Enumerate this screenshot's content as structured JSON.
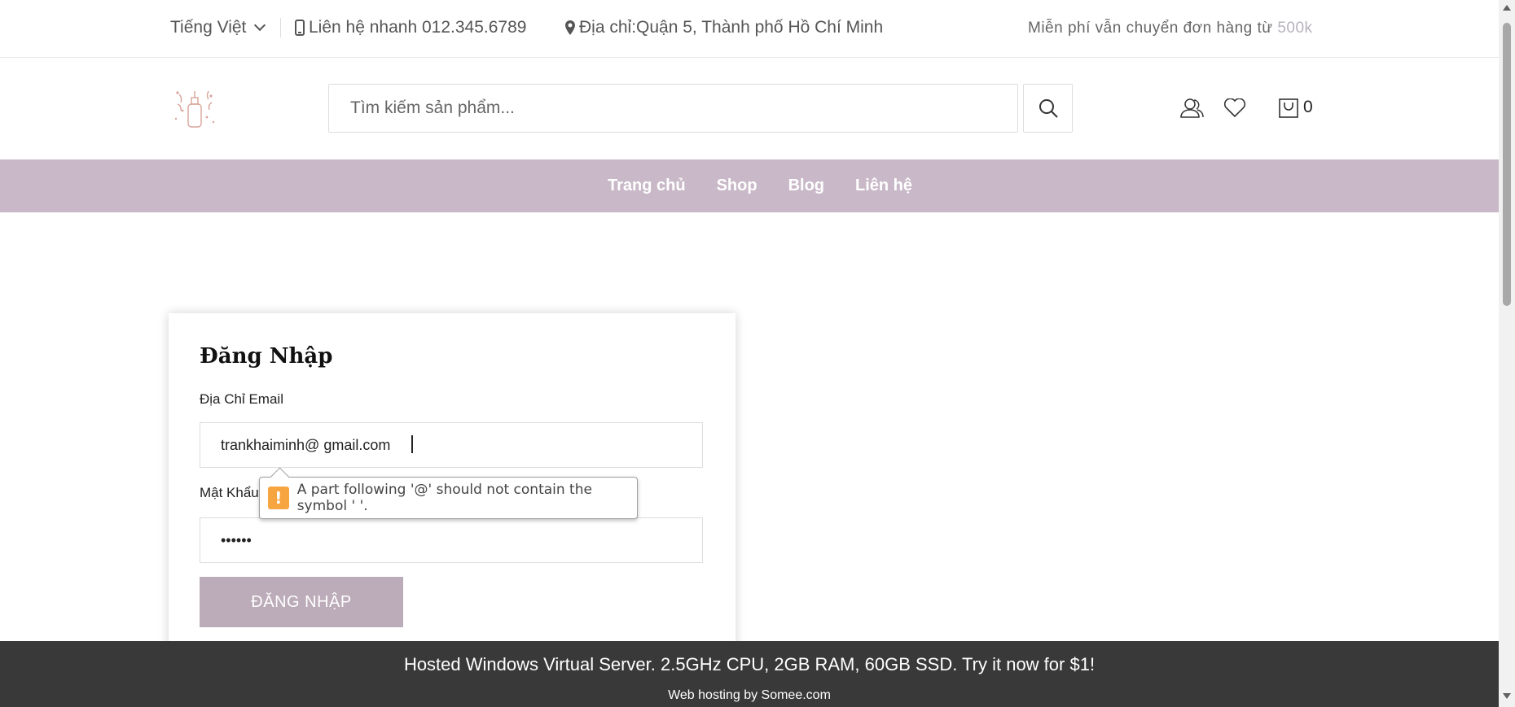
{
  "topbar": {
    "language": "Tiếng Việt",
    "phone_label": "Liên hệ nhanh 012.345.6789",
    "address_label": "Địa chỉ:Quận 5, Thành phố Hồ Chí Minh",
    "shipping_text": "Miễn phí vẫn chuyển đơn hàng từ",
    "shipping_amount": "500k"
  },
  "header": {
    "search_placeholder": "Tìm kiếm sản phẩm...",
    "cart_count": "0",
    "icons": [
      "search-icon",
      "user-icon",
      "heart-icon",
      "cart-icon"
    ]
  },
  "nav": {
    "items": [
      {
        "label": "Trang chủ"
      },
      {
        "label": "Shop"
      },
      {
        "label": "Blog"
      },
      {
        "label": "Liên hệ"
      }
    ]
  },
  "login": {
    "title": "Đăng Nhập",
    "email_label": "Địa Chỉ Email",
    "email_value": "trankhaiminh@ gmail.com",
    "password_label": "Mật Khẩu",
    "password_value": "••••••",
    "submit_label": "ĐĂNG NHẬP"
  },
  "tooltip": {
    "icon": "!",
    "message": "A part following '@' should not contain the symbol ' '."
  },
  "banner": {
    "line1": "Hosted Windows Virtual Server. 2.5GHz CPU, 2GB RAM, 60GB SSD. Try it now for $1!",
    "line2": "Web hosting by Somee.com"
  },
  "colors": {
    "nav_bg": "#c9b9c8",
    "button_bg": "#bcacb9",
    "warning": "#f7a541",
    "banner_bg": "#393939"
  }
}
